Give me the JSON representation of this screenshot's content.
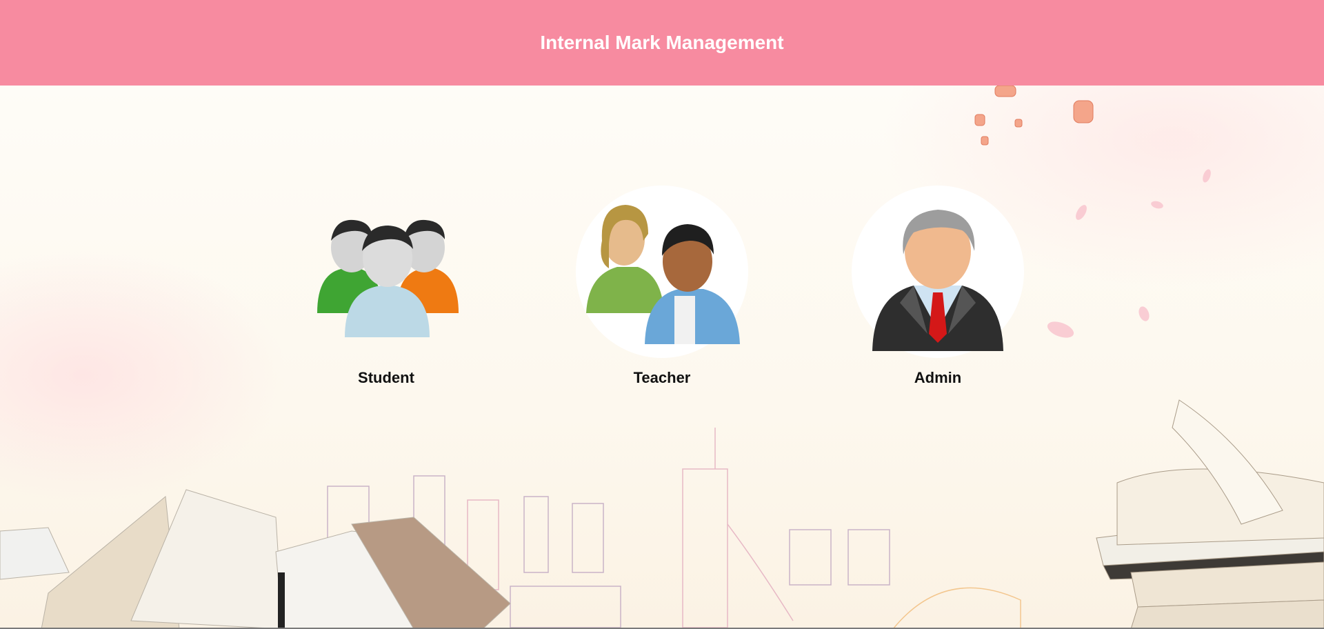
{
  "header": {
    "title": "Internal Mark Management"
  },
  "roles": [
    {
      "label": "Student",
      "icon": "student-group-icon"
    },
    {
      "label": "Teacher",
      "icon": "teacher-pair-icon"
    },
    {
      "label": "Admin",
      "icon": "admin-person-icon"
    }
  ],
  "colors": {
    "header_bg": "#f78ba0",
    "header_text": "#ffffff",
    "label_text": "#111111"
  }
}
